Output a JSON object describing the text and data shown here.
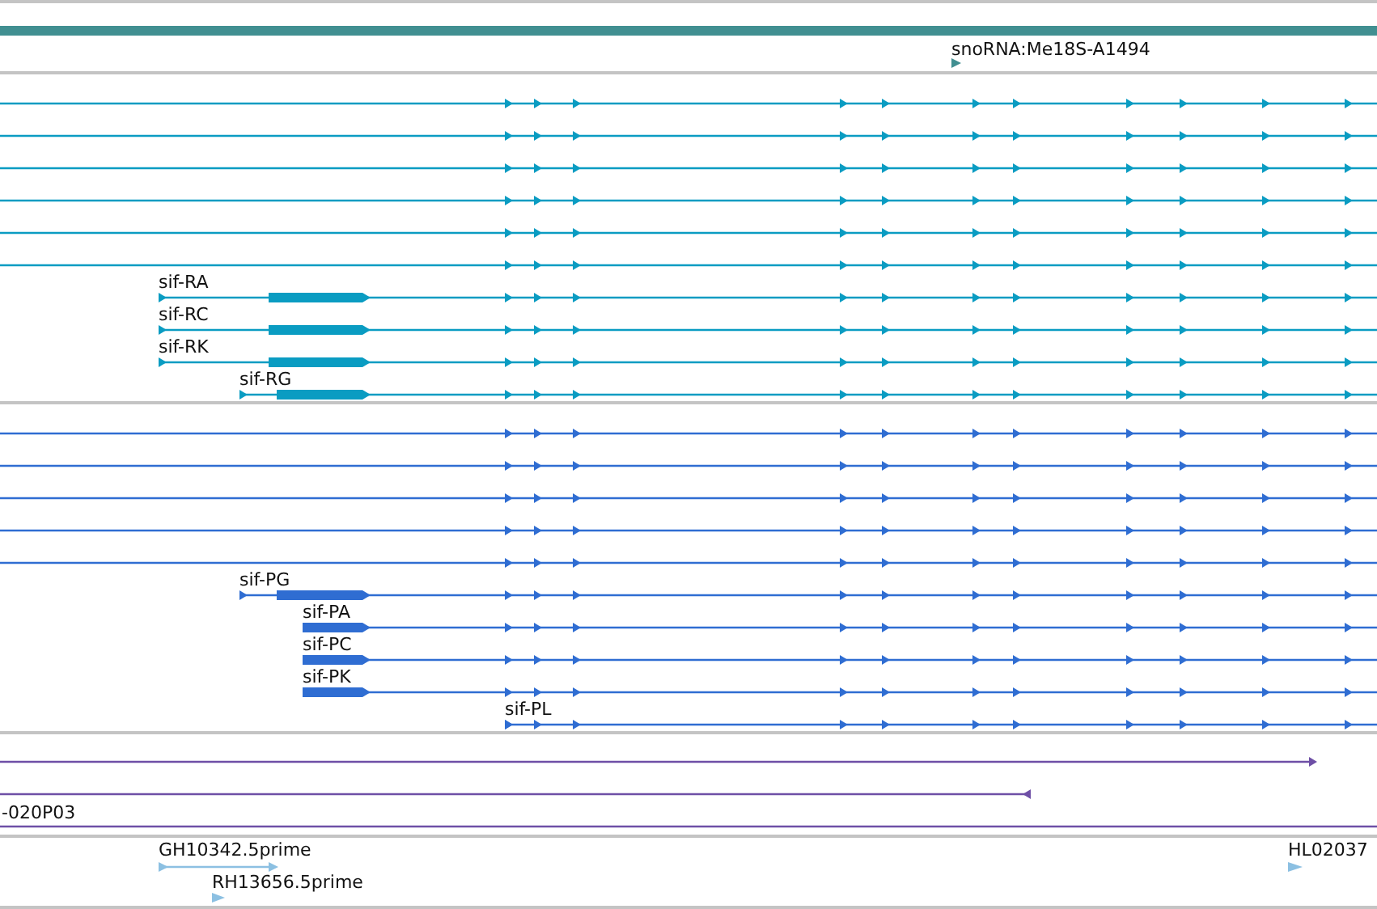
{
  "gene_track": {
    "label": "snoRNA:Me18S-A1494"
  },
  "rna_track": {
    "transcripts": [
      "sif-RA",
      "sif-RC",
      "sif-RK",
      "sif-RG"
    ]
  },
  "protein_track": {
    "proteins": [
      "sif-PG",
      "sif-PA",
      "sif-PC",
      "sif-PK",
      "sif-PL"
    ]
  },
  "clone_track": {
    "label": "-020P03"
  },
  "est_track": {
    "features": [
      "GH10342.5prime",
      "RH13656.5prime",
      "HL02037"
    ]
  }
}
